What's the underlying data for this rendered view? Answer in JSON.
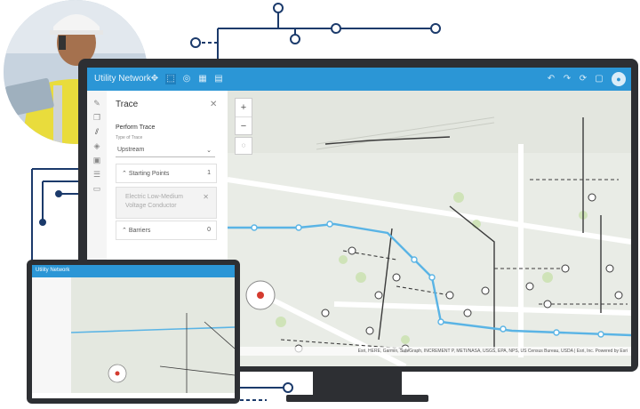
{
  "monitor": {
    "app_title": "Utility Network",
    "toolbar_icons": [
      "move-icon",
      "select-icon",
      "trace-icon",
      "grid-icon",
      "delete-icon"
    ],
    "right_icons": [
      "undo-icon",
      "redo-icon",
      "refresh-icon",
      "help-icon"
    ],
    "panel": {
      "title": "Trace",
      "perform_label": "Perform Trace",
      "type_label": "Type of Trace",
      "type_value": "Upstream",
      "starting_points_label": "Starting Points",
      "starting_points_count": "1",
      "starting_point_entry": "Electric Low-Medium Voltage Conductor",
      "barriers_label": "Barriers",
      "barriers_count": "0"
    },
    "map": {
      "zoom_in": "+",
      "zoom_out": "−",
      "attribution": "Esri, HERE, Garmin, SafeGraph, INCREMENT P, METI/NASA, USGS, EPA, NPS, US Census Bureau, USDA | Esri, Inc. Powered by Esri"
    }
  },
  "laptop": {
    "app_title": "Utility Network"
  },
  "colors": {
    "accent": "#2b96d6",
    "trace": "#5ab4e5",
    "bezel": "#2d2f33",
    "line_dark": "#3a3a3a"
  }
}
